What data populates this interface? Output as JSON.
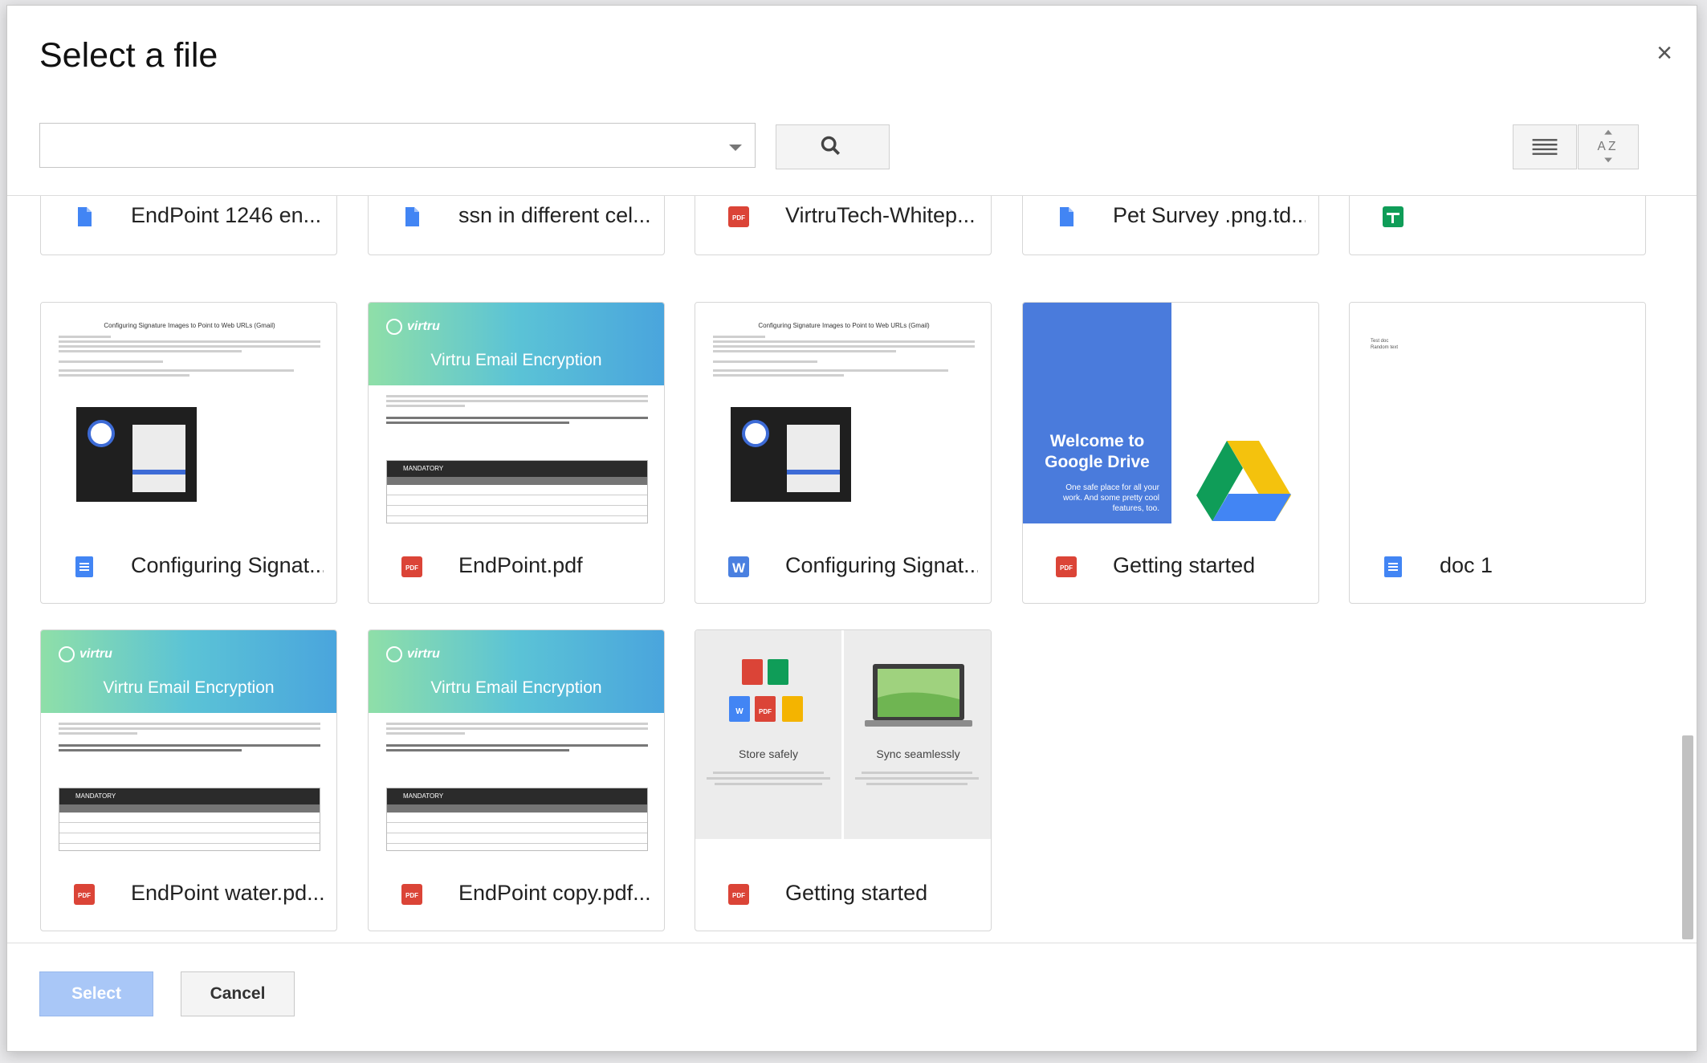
{
  "dialog": {
    "title": "Select a file",
    "close_label": "×"
  },
  "search": {
    "placeholder": ""
  },
  "files": {
    "row1": [
      {
        "name": "EndPoint 1246 en...",
        "type": "doc"
      },
      {
        "name": "ssn in different cel...",
        "type": "doc"
      },
      {
        "name": "VirtruTech-Whitep...",
        "type": "pdf"
      },
      {
        "name": "Pet Survey .png.td...",
        "type": "doc"
      },
      {
        "name": "",
        "type": "sheet"
      }
    ],
    "row2": [
      {
        "name": "Configuring Signat...",
        "type": "gdoc"
      },
      {
        "name": "EndPoint.pdf",
        "type": "pdf"
      },
      {
        "name": "Configuring Signat...",
        "type": "word"
      },
      {
        "name": "Getting started",
        "type": "pdf"
      },
      {
        "name": "doc 1",
        "type": "gdoc"
      }
    ],
    "row3": [
      {
        "name": "EndPoint water.pd...",
        "type": "pdf"
      },
      {
        "name": "EndPoint copy.pdf...",
        "type": "pdf"
      },
      {
        "name": "Getting started",
        "type": "pdf"
      }
    ]
  },
  "thumbs": {
    "config_title": "Configuring Signature Images to Point to Web URLs (Gmail)",
    "virtru_logo": "virtru",
    "virtru_title": "Virtru Email Encryption",
    "virtru_table_header": "MANDATORY",
    "welcome_heading": "Welcome to Google Drive",
    "welcome_sub": "One safe place for all your work. And some pretty cool features, too.",
    "doc1_text": "Test doc Random text",
    "store_title": "Store safely",
    "sync_title": "Sync seamlessly"
  },
  "footer": {
    "select_label": "Select",
    "cancel_label": "Cancel"
  },
  "colors": {
    "select_disabled": "#a9c7f7",
    "pdf_red": "#db4437",
    "doc_blue": "#4285f4",
    "sheet_green": "#0f9d58"
  }
}
